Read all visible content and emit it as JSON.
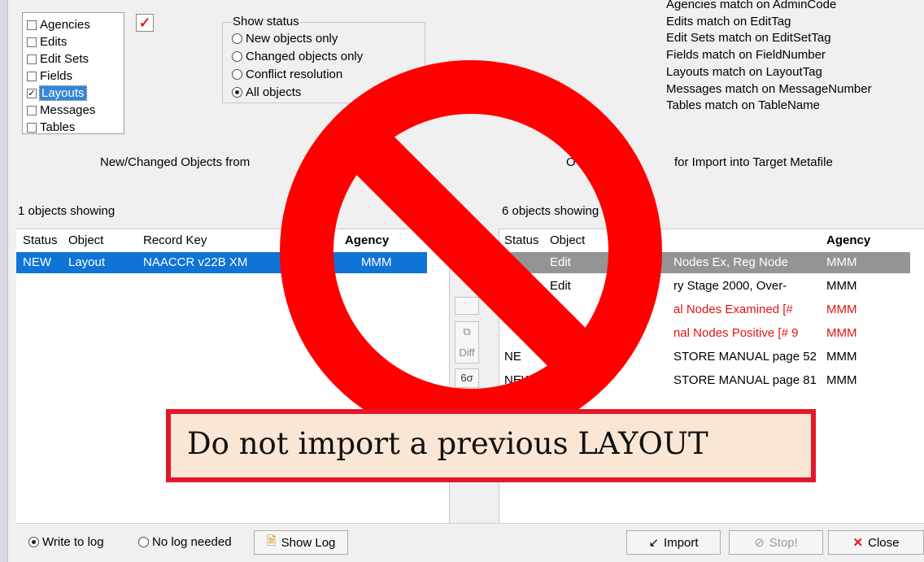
{
  "object_types": [
    {
      "label": "Agencies",
      "checked": false
    },
    {
      "label": "Edits",
      "checked": false
    },
    {
      "label": "Edit Sets",
      "checked": false
    },
    {
      "label": "Fields",
      "checked": false
    },
    {
      "label": "Layouts",
      "checked": true
    },
    {
      "label": "Messages",
      "checked": false
    },
    {
      "label": "Tables",
      "checked": false
    }
  ],
  "check_all_glyph": "✓",
  "show_status": {
    "title": "Show status",
    "options": [
      "New objects only",
      "Changed objects only",
      "Conflict resolution",
      "All objects"
    ],
    "selected": "All objects"
  },
  "match_rules": [
    "Agencies match on AdminCode",
    "Edits match on EditTag",
    "Edit Sets match on EditSetTag",
    "Fields match on FieldNumber",
    "Layouts match on LayoutTag",
    "Messages match on MessageNumber",
    "Tables match on TableName"
  ],
  "captions": {
    "left": "New/Changed Objects from",
    "right_prefix": "O",
    "right": "for Import into Target Metafile"
  },
  "left_pane": {
    "count": "1 objects showing",
    "headers": [
      "Status",
      "Object",
      "Record Key",
      "Agency"
    ],
    "rows": [
      {
        "status": "NEW",
        "object": "Layout",
        "key": "NAACCR v22B XM",
        "agency": "MMM"
      }
    ]
  },
  "right_pane": {
    "count": "6 objects showing",
    "headers": [
      "Status",
      "Object",
      "Agency"
    ],
    "rows": [
      {
        "status": "",
        "object": "Edit",
        "key": "Nodes Ex, Reg Node",
        "agency": "MMM"
      },
      {
        "status": "",
        "object": "Edit",
        "key": "ry Stage 2000, Over-",
        "agency": "MMM"
      },
      {
        "status": "",
        "object": "",
        "key": "al Nodes Examined [#",
        "agency": "MMM"
      },
      {
        "status": "",
        "object": "",
        "key": "nal Nodes Positive [# 9",
        "agency": "MMM"
      },
      {
        "status": "NE",
        "object": "",
        "key": "STORE MANUAL page 52",
        "agency": "MMM"
      },
      {
        "status": "NEW",
        "object": "",
        "key": "STORE MANUAL page 81",
        "agency": "MMM"
      }
    ]
  },
  "mid_buttons": {
    "diff_label": "Diff",
    "glasses_glyph": "6σ"
  },
  "bottom": {
    "write_log": "Write to log",
    "no_log": "No log needed",
    "log_selected": "Write to log",
    "show_log": "Show Log",
    "import": "Import",
    "stop": "Stop!",
    "close": "Close"
  },
  "overlay": {
    "warning": "Do not import a previous LAYOUT",
    "colors": {
      "sign": "#ff0000",
      "box_fill": "#fae6d4",
      "box_border": "#e3172b"
    }
  }
}
